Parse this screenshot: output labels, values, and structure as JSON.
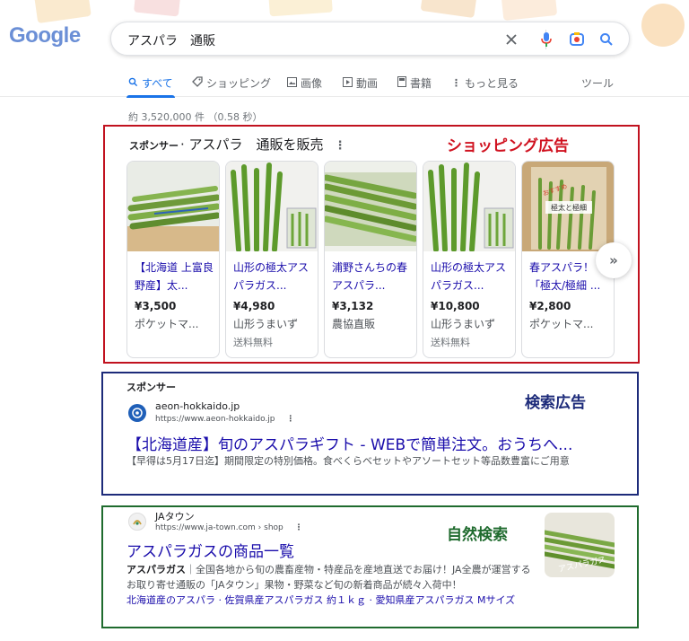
{
  "logo": {
    "text": "Google"
  },
  "search": {
    "query": "アスパラ　通販"
  },
  "icons": {
    "clear": "close-icon",
    "voice": "microphone-icon",
    "lens": "camera-lens-icon",
    "search": "search-icon"
  },
  "tabs": [
    {
      "label": "すべて",
      "icon": "search-icon",
      "active": true
    },
    {
      "label": "ショッピング",
      "icon": "tag-icon"
    },
    {
      "label": "画像",
      "icon": "image-icon"
    },
    {
      "label": "動画",
      "icon": "play-icon"
    },
    {
      "label": "書籍",
      "icon": "book-icon"
    },
    {
      "label": "もっと見る",
      "icon": "more-vert-icon"
    }
  ],
  "tools_label": "ツール",
  "result_stats": "約 3,520,000 件 （0.58 秒）",
  "shopping_ad": {
    "sponsor_label": "スポンサー",
    "heading": "· アスパラ　通販を販売",
    "annotation": "ショッピング広告",
    "products": [
      {
        "title": "【北海道 上富良野産】太...",
        "price": "¥3,500",
        "seller": "ポケットマ...",
        "shipping": ""
      },
      {
        "title": "山形の極太アスパラガス...",
        "price": "¥4,980",
        "seller": "山形うまいず",
        "shipping": "送料無料"
      },
      {
        "title": "浦野さんちの春アスパラ...",
        "price": "¥3,132",
        "seller": "農協直販",
        "shipping": ""
      },
      {
        "title": "山形の極太アスパラガス...",
        "price": "¥10,800",
        "seller": "山形うまいず",
        "shipping": "送料無料"
      },
      {
        "title": "春アスパラ！「極太/極細 ...",
        "price": "¥2,800",
        "seller": "ポケットマ...",
        "shipping": ""
      }
    ],
    "product_image_text": {
      "box_label": "極太と極細",
      "tag": "おすすめ"
    },
    "next_label": "»"
  },
  "text_ad": {
    "sponsor_label": "スポンサー",
    "annotation": "検索広告",
    "site_name": "aeon-hokkaido.jp",
    "url": "https://www.aeon-hokkaido.jp",
    "title": "【北海道産】旬のアスパラギフト - WEBで簡単注文。おうちへ...",
    "description": "【早得は5月17日迄】期間限定の特別価格。食べくらベセットやアソートセット等品数豊富にご用意"
  },
  "organic": {
    "annotation": "自然検索",
    "site_name": "JAタウン",
    "url": "https://www.ja-town.com › shop",
    "title": "アスパラガスの商品一覧",
    "description_bold": "アスパラガス",
    "description": "｜全国各地から旬の農畜産物・特産品を産地直送でお届け！JA全農が運営するお取り寄せ通販の「JAタウン」果物・野菜など旬の新着商品が続々入荷中！",
    "links": "北海道産のアスパラ · 佐賀県産アスパラガス 約１ｋｇ · 愛知県産アスパラガス Mサイズ",
    "thumb_text": "アスパラガス"
  },
  "colors": {
    "ad_shopping": "#c1121f",
    "ad_search": "#1d2b7a",
    "organic": "#1f6b2e",
    "link": "#1a0dab",
    "accent": "#1a73e8"
  }
}
